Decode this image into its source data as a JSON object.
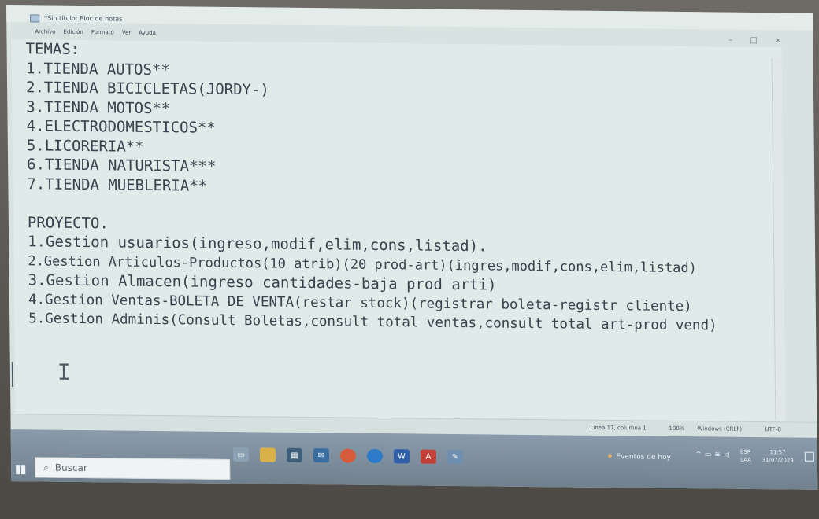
{
  "window": {
    "title": "*Sin título: Bloc de notas",
    "minimize": "–",
    "maximize": "□",
    "close": "×"
  },
  "menu": [
    "Archivo",
    "Edición",
    "Formato",
    "Ver",
    "Ayuda"
  ],
  "editor": {
    "lines": [
      "TEMAS:",
      "1.TIENDA AUTOS**",
      "2.TIENDA BICICLETAS(JORDY-)",
      "3.TIENDA MOTOS**",
      "4.ELECTRODOMESTICOS**",
      "5.LICORERIA**",
      "6.TIENDA NATURISTA***",
      "7.TIENDA MUEBLERIA**",
      "",
      "PROYECTO.",
      "1.Gestion usuarios(ingreso,modif,elim,cons,listad).",
      "2.Gestion Articulos-Productos(10 atrib)(20 prod-art)(ingres,modif,cons,elim,listad)",
      "3.Gestion Almacen(ingreso cantidades-baja prod arti)",
      "4.Gestion Ventas-BOLETA DE VENTA(restar stock)(registrar boleta-registr cliente)",
      "5.Gestion Adminis(Consult Boletas,consult total ventas,consult total art-prod vend)"
    ]
  },
  "status": {
    "position": "Línea 17, columna 1",
    "zoom": "100%",
    "line_ending": "Windows (CRLF)",
    "encoding": "UTF-8"
  },
  "taskbar": {
    "search_placeholder": "Buscar",
    "events": "Eventos de hoy",
    "lang_top": "ESP",
    "lang_bottom": "LAA",
    "time": "11:57",
    "date": "31/07/2024"
  }
}
